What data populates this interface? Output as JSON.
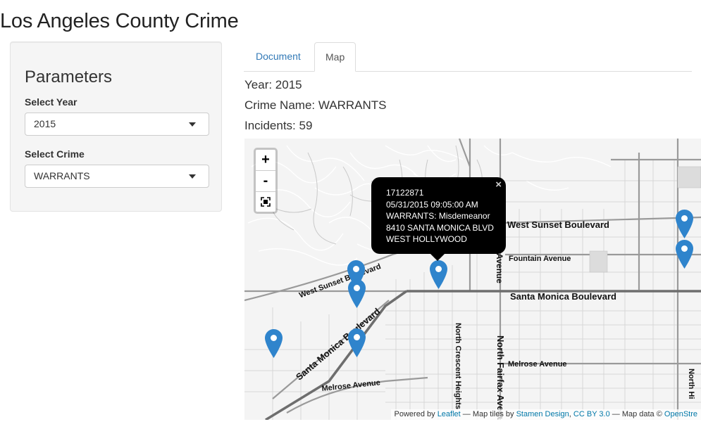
{
  "app": {
    "title": "Los Angeles County Crime"
  },
  "sidebar": {
    "heading": "Parameters",
    "year_label": "Select Year",
    "year_value": "2015",
    "crime_label": "Select Crime",
    "crime_value": "WARRANTS"
  },
  "tabs": [
    {
      "label": "Document",
      "active": false
    },
    {
      "label": "Map",
      "active": true
    }
  ],
  "summary": {
    "year": "Year: 2015",
    "crime": "Crime Name: WARRANTS",
    "incidents": "Incidents: 59"
  },
  "map": {
    "zoom_in": "+",
    "zoom_out": "-",
    "popup": {
      "close": "×",
      "lines": [
        "17122871",
        "05/31/2015 09:05:00 AM",
        "WARRANTS: Misdemeanor",
        "8410 SANTA MONICA BLVD",
        "WEST HOLLYWOOD"
      ]
    },
    "road_labels": {
      "west_sunset": "West Sunset Boulevard",
      "fountain": "Fountain Avenue",
      "santa_monica": "Santa Monica Boulevard",
      "melrose_right": "Melrose Avenue",
      "melrose_left": "Melrose Avenue",
      "west_sunset_diag": "West Sunset Boulevard",
      "santa_monica_diag": "Santa Monica Boulevard",
      "crescent": "North Crescent Heights",
      "fairfax": "North Fairfax Avenue",
      "avenue_partial": "Avenue",
      "north_hi": "North Hi"
    },
    "attribution": {
      "powered_by": "Powered by ",
      "leaflet": "Leaflet",
      "tiles_text": " — Map tiles by ",
      "stamen": "Stamen Design",
      "sep": ", ",
      "cc": "CC BY 3.0",
      "data_text": " — Map data © ",
      "osm": "OpenStre"
    },
    "marker_color": "#2f84cc"
  }
}
